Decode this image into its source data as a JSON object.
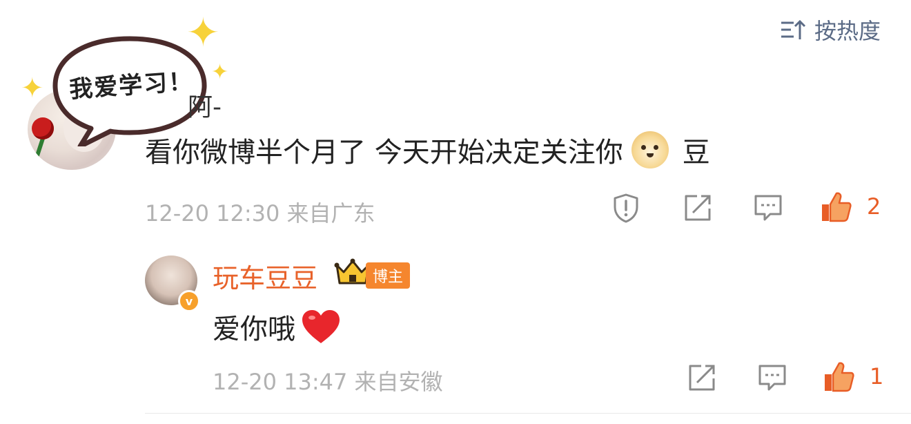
{
  "sort": {
    "label": "按热度",
    "icon": "sort-icon"
  },
  "comment": {
    "sticker_text": "我爱学习！",
    "username": "阿-",
    "content_text": "看你微博半个月了 今天开始决定关注你",
    "emoji": "doge-emoji",
    "content_suffix": "豆",
    "time": "12-20 12:30",
    "location": "来自广东",
    "like_count": "2"
  },
  "reply": {
    "username": "玩车豆豆",
    "badge_label": "博主",
    "content_text": "爱你哦",
    "emoji": "heart-emoji",
    "time": "12-20 13:47",
    "location": "来自安徽",
    "like_count": "1"
  },
  "colors": {
    "accent": "#e8622a",
    "like": "#e85d26",
    "meta": "#b2b2b2",
    "star": "#f7d23a",
    "sort": "#5b6b86"
  }
}
